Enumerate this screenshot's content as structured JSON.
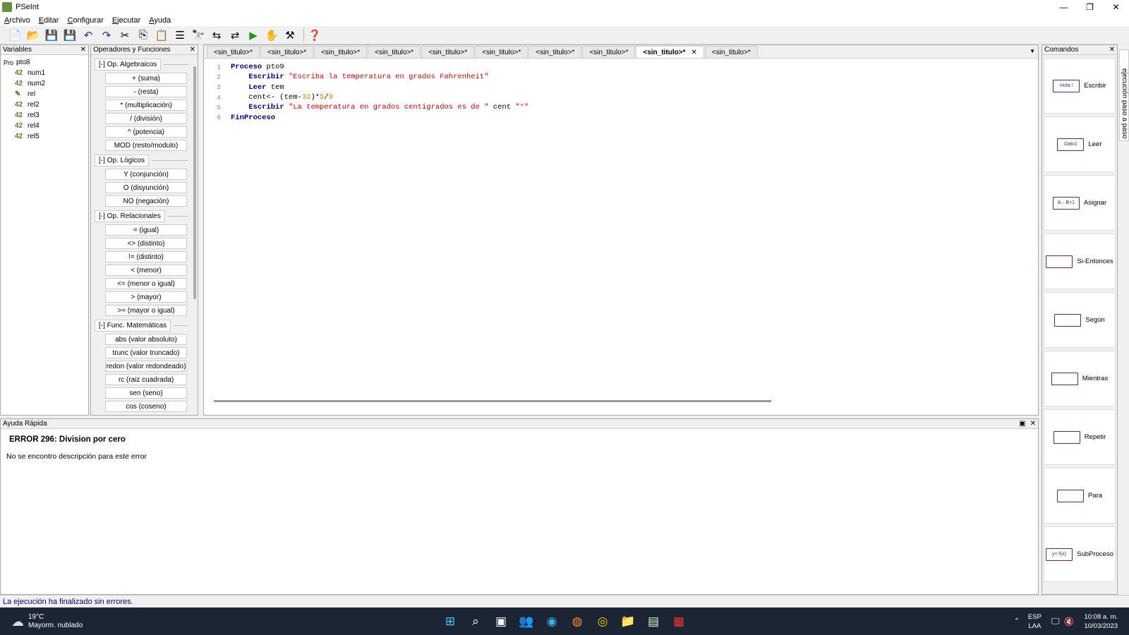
{
  "window": {
    "title": "PSeInt"
  },
  "menu": [
    "Archivo",
    "Editar",
    "Configurar",
    "Ejecutar",
    "Ayuda"
  ],
  "variables": {
    "title": "Variables",
    "root": "pto8",
    "items": [
      {
        "badge": "42",
        "name": "num1"
      },
      {
        "badge": "42",
        "name": "num2"
      },
      {
        "badge": "",
        "name": "rel"
      },
      {
        "badge": "42",
        "name": "rel2"
      },
      {
        "badge": "42",
        "name": "rel3"
      },
      {
        "badge": "42",
        "name": "rel4"
      },
      {
        "badge": "42",
        "name": "rel5"
      }
    ]
  },
  "operators": {
    "title": "Operadores y Funciones",
    "groups": [
      {
        "title": "[-]  Op. Algebraicos",
        "items": [
          "+ (suma)",
          "- (resta)",
          "* (multiplicación)",
          "/ (división)",
          "^ (potencia)",
          "MOD (resto/modulo)"
        ]
      },
      {
        "title": "[-]  Op. Lógicos",
        "items": [
          "Y (conjunción)",
          "O (disyunción)",
          "NO (negación)"
        ]
      },
      {
        "title": "[-]  Op. Relacionales",
        "items": [
          "= (igual)",
          "<> (distinto)",
          "!= (distinto)",
          "< (menor)",
          "<= (menor o igual)",
          "> (mayor)",
          ">= (mayor o igual)"
        ]
      },
      {
        "title": "[-]  Func. Matemáticas",
        "items": [
          "abs (valor absoluto)",
          "trunc (valor truncado)",
          "redon (valor redondeado)",
          "rc (raiz cuadrada)",
          "sen (seno)",
          "cos (coseno)"
        ]
      }
    ]
  },
  "editor": {
    "tabs": [
      "<sin_titulo>*",
      "<sin_titulo>*",
      "<sin_titulo>*",
      "<sin_titulo>*",
      "<sin_titulo>*",
      "<sin_titulo>*",
      "<sin_titulo>*",
      "<sin_titulo>*",
      "<sin_titulo>*",
      "<sin_titulo>*"
    ],
    "active_tab": 8,
    "lines": [
      {
        "n": "1",
        "parts": [
          [
            "kw",
            "Proceso"
          ],
          [
            "",
            " pto9"
          ]
        ]
      },
      {
        "n": "2",
        "parts": [
          [
            "",
            "    "
          ],
          [
            "kw",
            "Escribir"
          ],
          [
            "",
            " "
          ],
          [
            "str",
            "\"Escriba la temperatura en grados Fahrenheit\""
          ]
        ]
      },
      {
        "n": "3",
        "parts": [
          [
            "",
            "    "
          ],
          [
            "kw",
            "Leer"
          ],
          [
            "",
            " tem"
          ]
        ]
      },
      {
        "n": "4",
        "parts": [
          [
            "",
            "    cent<- (tem-"
          ],
          [
            "num",
            "32"
          ],
          [
            "",
            ")*"
          ],
          [
            "num",
            "5"
          ],
          [
            "",
            "/"
          ],
          [
            "num",
            "9"
          ]
        ]
      },
      {
        "n": "5",
        "parts": [
          [
            "",
            "    "
          ],
          [
            "kw",
            "Escribir"
          ],
          [
            "",
            " "
          ],
          [
            "str",
            "\"La temperatura en grados centigrados es de \""
          ],
          [
            "",
            " cent "
          ],
          [
            "str",
            "\"°\""
          ]
        ]
      },
      {
        "n": "6",
        "parts": [
          [
            "kw",
            "FinProceso"
          ]
        ]
      }
    ]
  },
  "help": {
    "title": "Ayuda Rápida",
    "error": "ERROR 296: Division por cero",
    "description": "No se encontro descripción para este error"
  },
  "commands": {
    "title": "Comandos",
    "items": [
      {
        "label": "Escribir",
        "icon": "Hola !"
      },
      {
        "label": "Leer",
        "icon": "Dato1"
      },
      {
        "label": "Asignar",
        "icon": "A←B+1"
      },
      {
        "label": "Si-Entonces",
        "icon": "si"
      },
      {
        "label": "Según",
        "icon": "seg"
      },
      {
        "label": "Mientras",
        "icon": "mie"
      },
      {
        "label": "Repetir",
        "icon": "rep"
      },
      {
        "label": "Para",
        "icon": "para"
      },
      {
        "label": "SubProceso",
        "icon": "y<-f(x)"
      }
    ],
    "side_tab": "ejecución paso a paso"
  },
  "status": "La ejecución ha finalizado sin errores.",
  "taskbar": {
    "weather_temp": "19°C",
    "weather_desc": "Mayorm. nublado",
    "lang1": "ESP",
    "lang2": "LAA",
    "time": "10:08 a. m.",
    "date": "10/03/2023"
  }
}
